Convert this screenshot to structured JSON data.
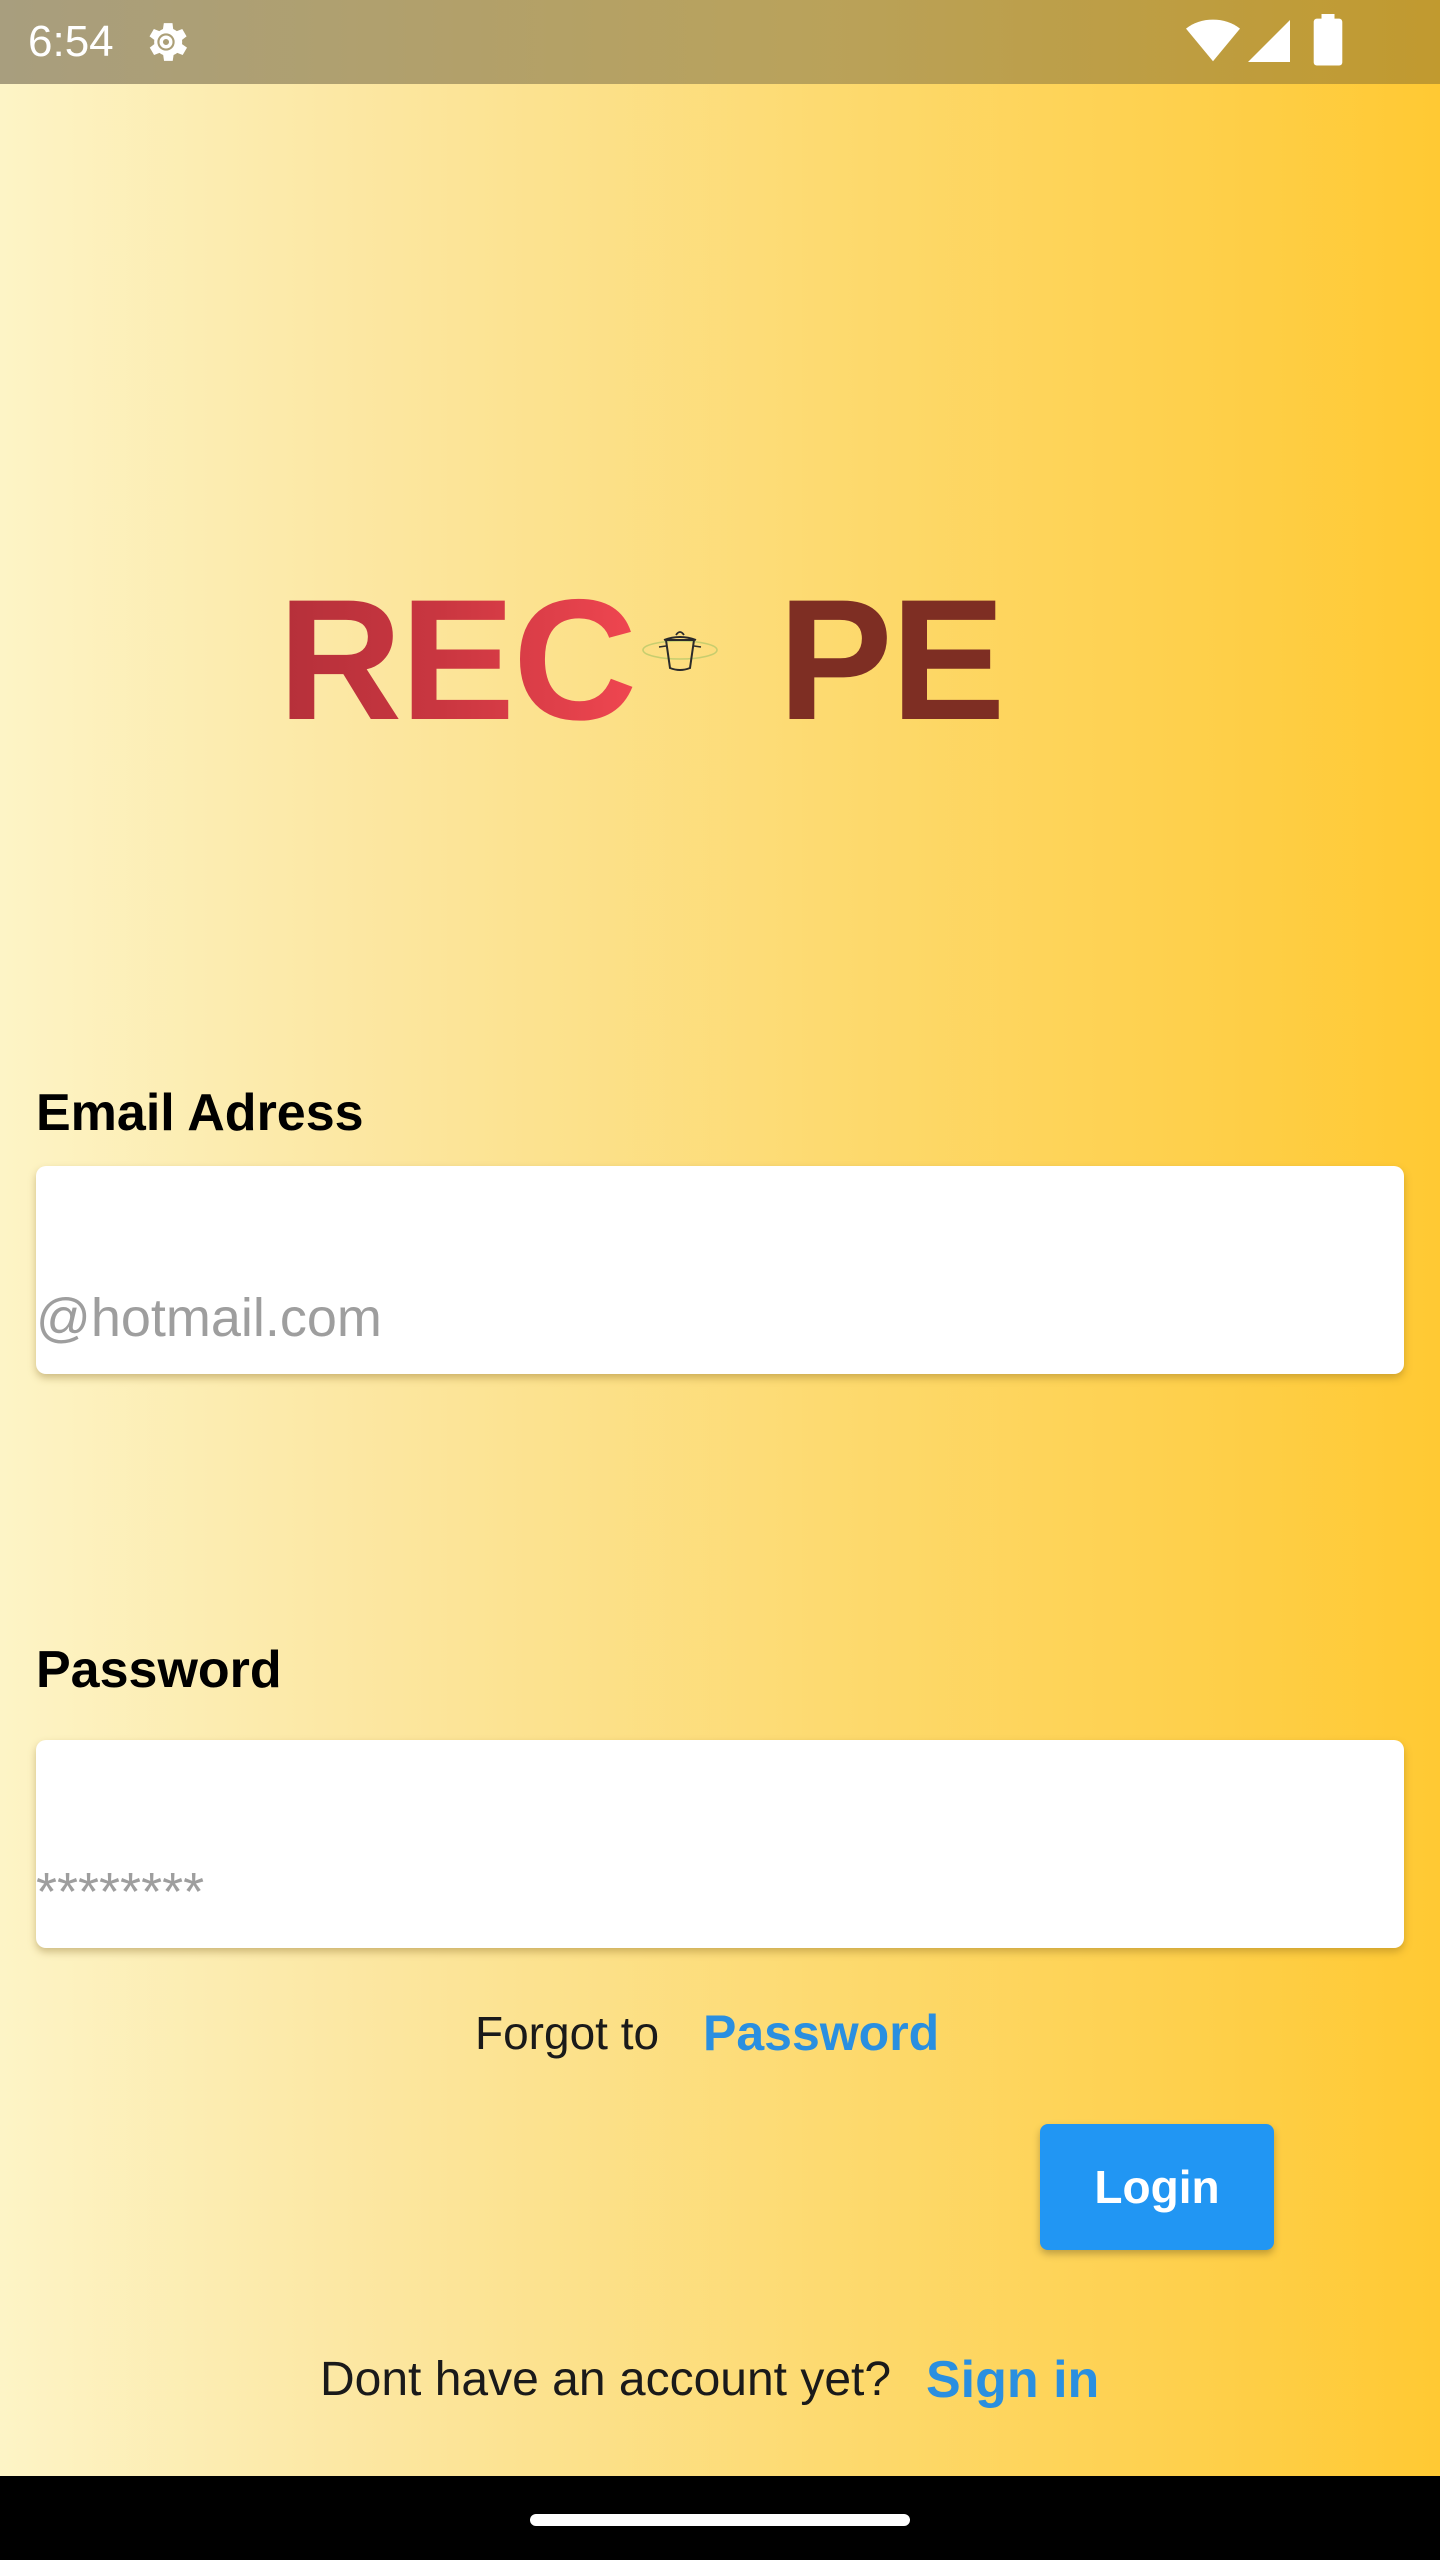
{
  "status_bar": {
    "time": "6:54",
    "icons": [
      "settings-icon",
      "wifi-icon",
      "signal-icon",
      "battery-icon"
    ]
  },
  "logo": {
    "left_text": "REC",
    "right_text": "PE",
    "center_icon": "cooking-pot-icon",
    "colors": {
      "left": "#c93640",
      "right": "#7e2e23"
    }
  },
  "email": {
    "label": "Email Adress",
    "placeholder": "@hotmail.com",
    "value": ""
  },
  "password": {
    "label": "Password",
    "placeholder": "********",
    "value": ""
  },
  "forgot": {
    "text": "Forgot to",
    "link": "Password"
  },
  "login_button": {
    "label": "Login"
  },
  "signup": {
    "text": "Dont have an account yet?",
    "link": "Sign in"
  },
  "colors": {
    "accent": "#2196f3",
    "link": "#2a8fe0",
    "background_start": "#fdf4c6",
    "background_end": "#ffc933"
  }
}
